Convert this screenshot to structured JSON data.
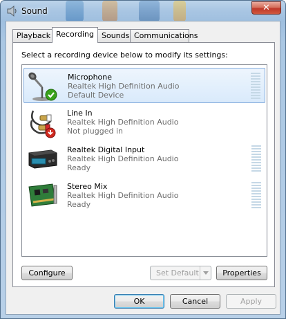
{
  "window": {
    "title": "Sound",
    "close_glyph": "✕"
  },
  "tabs": [
    {
      "label": "Playback",
      "active": false
    },
    {
      "label": "Recording",
      "active": true
    },
    {
      "label": "Sounds",
      "active": false
    },
    {
      "label": "Communications",
      "active": false
    }
  ],
  "recording": {
    "instruction": "Select a recording device below to modify its settings:",
    "devices": [
      {
        "name": "Microphone",
        "description": "Realtek High Definition Audio",
        "status": "Default Device",
        "icon": "microphone-icon",
        "badge": "default-check-icon",
        "selected": true,
        "meter": true
      },
      {
        "name": "Line In",
        "description": "Realtek High Definition Audio",
        "status": "Not plugged in",
        "icon": "rca-cable-icon",
        "badge": "unplugged-arrow-icon",
        "selected": false,
        "meter": false
      },
      {
        "name": "Realtek Digital Input",
        "description": "Realtek High Definition Audio",
        "status": "Ready",
        "icon": "digital-input-device-icon",
        "badge": null,
        "selected": false,
        "meter": true
      },
      {
        "name": "Stereo Mix",
        "description": "Realtek High Definition Audio",
        "status": "Ready",
        "icon": "sound-card-icon",
        "badge": null,
        "selected": false,
        "meter": true
      }
    ],
    "configure_label": "Configure",
    "set_default_label": "Set Default",
    "properties_label": "Properties"
  },
  "dialog": {
    "ok_label": "OK",
    "cancel_label": "Cancel",
    "apply_label": "Apply"
  },
  "colors": {
    "selection_border": "#84acdd",
    "meter_idle": "#c5d8e6",
    "check_green": "#3aa21d",
    "unplugged_red": "#d02a1f"
  }
}
